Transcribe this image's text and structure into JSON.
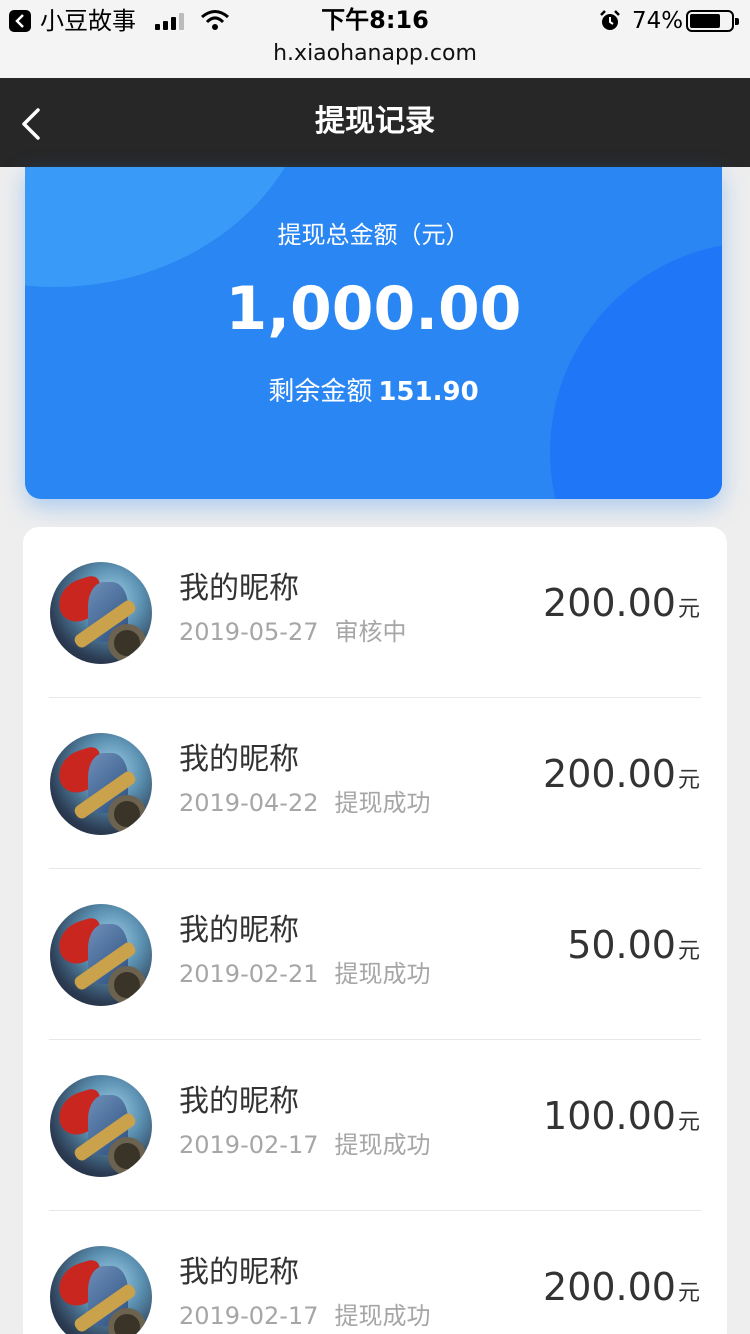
{
  "status_bar": {
    "back_app": "小豆故事",
    "time": "下午8:16",
    "battery": "74%",
    "battery_level": 0.74,
    "url": "h.xiaohanapp.com"
  },
  "nav": {
    "title": "提现记录"
  },
  "summary": {
    "label": "提现总金额（元）",
    "total": "1,000.00",
    "remain_label": "剩余金额",
    "remain_value": "151.90"
  },
  "records": [
    {
      "name": "我的昵称",
      "date": "2019-05-27",
      "status": "审核中",
      "amount": "200.00",
      "unit": "元"
    },
    {
      "name": "我的昵称",
      "date": "2019-04-22",
      "status": "提现成功",
      "amount": "200.00",
      "unit": "元"
    },
    {
      "name": "我的昵称",
      "date": "2019-02-21",
      "status": "提现成功",
      "amount": "50.00",
      "unit": "元"
    },
    {
      "name": "我的昵称",
      "date": "2019-02-17",
      "status": "提现成功",
      "amount": "100.00",
      "unit": "元"
    },
    {
      "name": "我的昵称",
      "date": "2019-02-17",
      "status": "提现成功",
      "amount": "200.00",
      "unit": "元"
    }
  ],
  "colors": {
    "navbar": "#272727",
    "summary_blue": "#2a86f2",
    "muted_text": "#a6a6a6"
  }
}
